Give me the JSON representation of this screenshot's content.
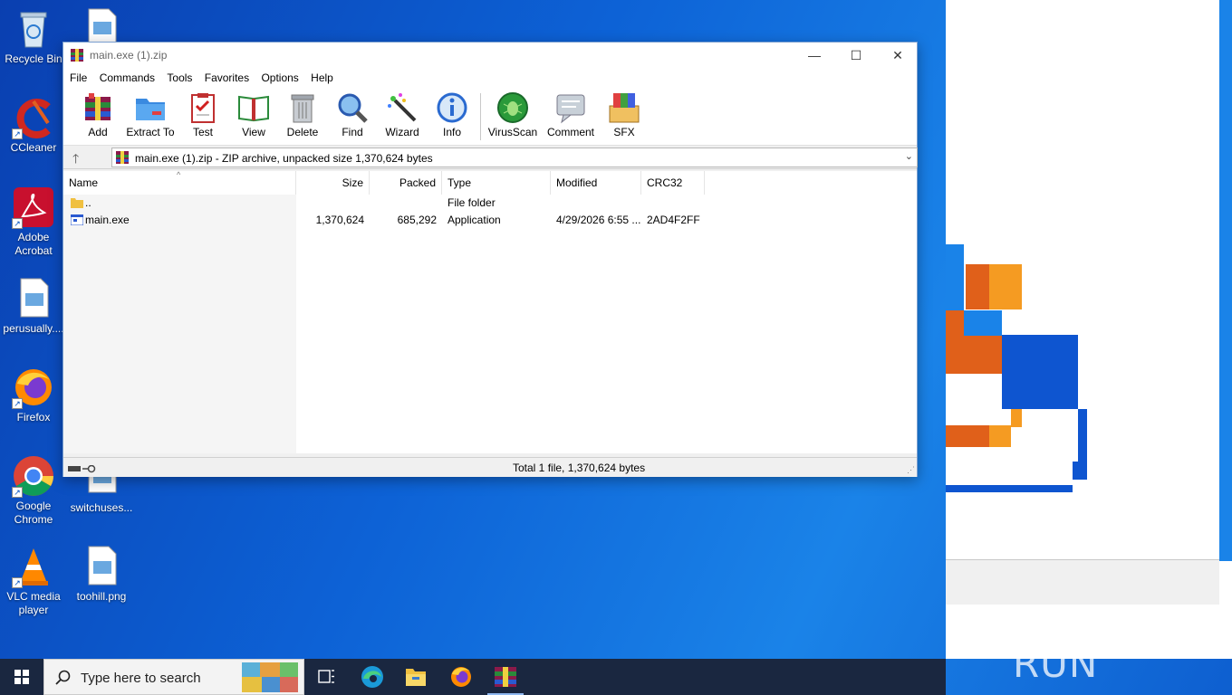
{
  "desktop": {
    "icons": [
      {
        "label": "Recycle Bin"
      },
      {
        "label": "CCleaner"
      },
      {
        "label": "Adobe Acrobat"
      },
      {
        "label": "perusually...."
      },
      {
        "label": "Firefox"
      },
      {
        "label": "Google Chrome"
      },
      {
        "label": "VLC media player"
      },
      {
        "label": "switchuses..."
      },
      {
        "label": "toohill.png"
      }
    ]
  },
  "window": {
    "title": "main.exe (1).zip",
    "controls": {
      "minimize": "—",
      "maximize": "☐",
      "close": "✕"
    }
  },
  "menu": [
    "File",
    "Commands",
    "Tools",
    "Favorites",
    "Options",
    "Help"
  ],
  "toolbar": [
    "Add",
    "Extract To",
    "Test",
    "View",
    "Delete",
    "Find",
    "Wizard",
    "Info",
    "VirusScan",
    "Comment",
    "SFX"
  ],
  "address": {
    "text": "main.exe (1).zip - ZIP archive, unpacked size 1,370,624 bytes",
    "up": "🡑",
    "dropdown": "⌄"
  },
  "columns": [
    "Name",
    "Size",
    "Packed",
    "Type",
    "Modified",
    "CRC32"
  ],
  "rows": [
    {
      "name": "..",
      "size": "",
      "packed": "",
      "type": "File folder",
      "modified": "",
      "crc": ""
    },
    {
      "name": "main.exe",
      "size": "1,370,624",
      "packed": "685,292",
      "type": "Application",
      "modified": "4/29/2026 6:55 ...",
      "crc": "2AD4F2FF"
    }
  ],
  "status": {
    "text": "Total 1 file, 1,370,624 bytes"
  },
  "taskbar": {
    "search_placeholder": "Type here to search"
  },
  "watermark": "ANY ▷ RUN",
  "colors": {
    "accent": "#0d62d6",
    "taskbar": "#1a2740",
    "folder": "#f0c040"
  }
}
